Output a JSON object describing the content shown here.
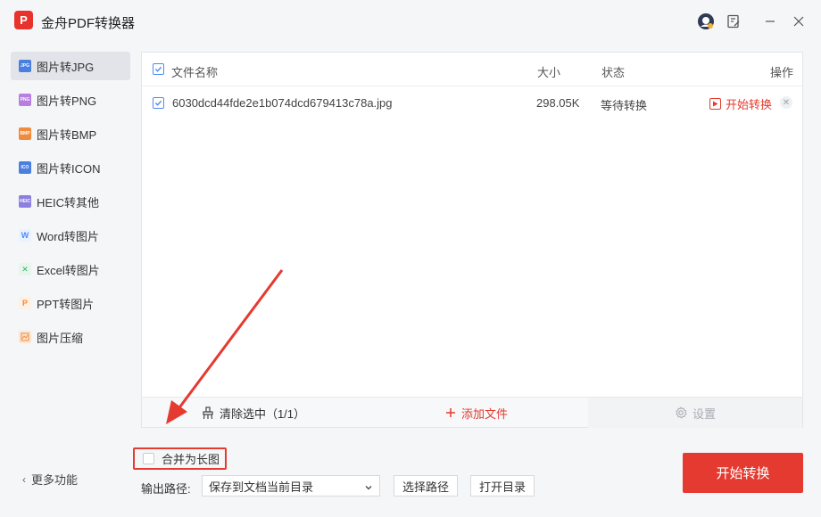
{
  "app": {
    "title": "金舟PDF转换器",
    "logo_text": "P"
  },
  "sidebar": {
    "items": [
      {
        "label": "图片转JPG",
        "icon": "jpg-icon",
        "color": "#4a7fe0",
        "tag": "JPG"
      },
      {
        "label": "图片转PNG",
        "icon": "png-icon",
        "color": "#b77fe0",
        "tag": "PNG"
      },
      {
        "label": "图片转BMP",
        "icon": "bmp-icon",
        "color": "#f08a3c",
        "tag": "BMP"
      },
      {
        "label": "图片转ICON",
        "icon": "ico-icon",
        "color": "#4a7fe0",
        "tag": "ICO"
      },
      {
        "label": "HEIC转其他",
        "icon": "heic-icon",
        "color": "#8c7fe0",
        "tag": "HEIC"
      },
      {
        "label": "Word转图片",
        "icon": "word-icon",
        "color": "#4a8cf5",
        "tag": "W"
      },
      {
        "label": "Excel转图片",
        "icon": "excel-icon",
        "color": "#33b36b",
        "tag": "X"
      },
      {
        "label": "PPT转图片",
        "icon": "ppt-icon",
        "color": "#f08a3c",
        "tag": "P"
      },
      {
        "label": "图片压缩",
        "icon": "compress-icon",
        "color": "#f08a3c",
        "tag": ""
      }
    ],
    "active_index": 0,
    "more_label": "更多功能"
  },
  "table": {
    "columns": {
      "name": "文件名称",
      "size": "大小",
      "status": "状态",
      "action": "操作"
    },
    "rows": [
      {
        "name": "6030dcd44fde2e1b074dcd679413c78a.jpg",
        "size": "298.05K",
        "status": "等待转换",
        "action": "开始转换",
        "checked": true
      }
    ]
  },
  "toolbar": {
    "clear_label": "清除选中（1/1）",
    "add_label": "添加文件",
    "settings_label": "设置"
  },
  "options": {
    "merge_label": "合并为长图",
    "merge_checked": false
  },
  "output": {
    "label": "输出路径:",
    "selected": "保存到文档当前目录",
    "choose_label": "选择路径",
    "open_label": "打开目录"
  },
  "start_button": "开始转换",
  "colors": {
    "accent": "#e53a30",
    "check": "#4a8cf5"
  }
}
